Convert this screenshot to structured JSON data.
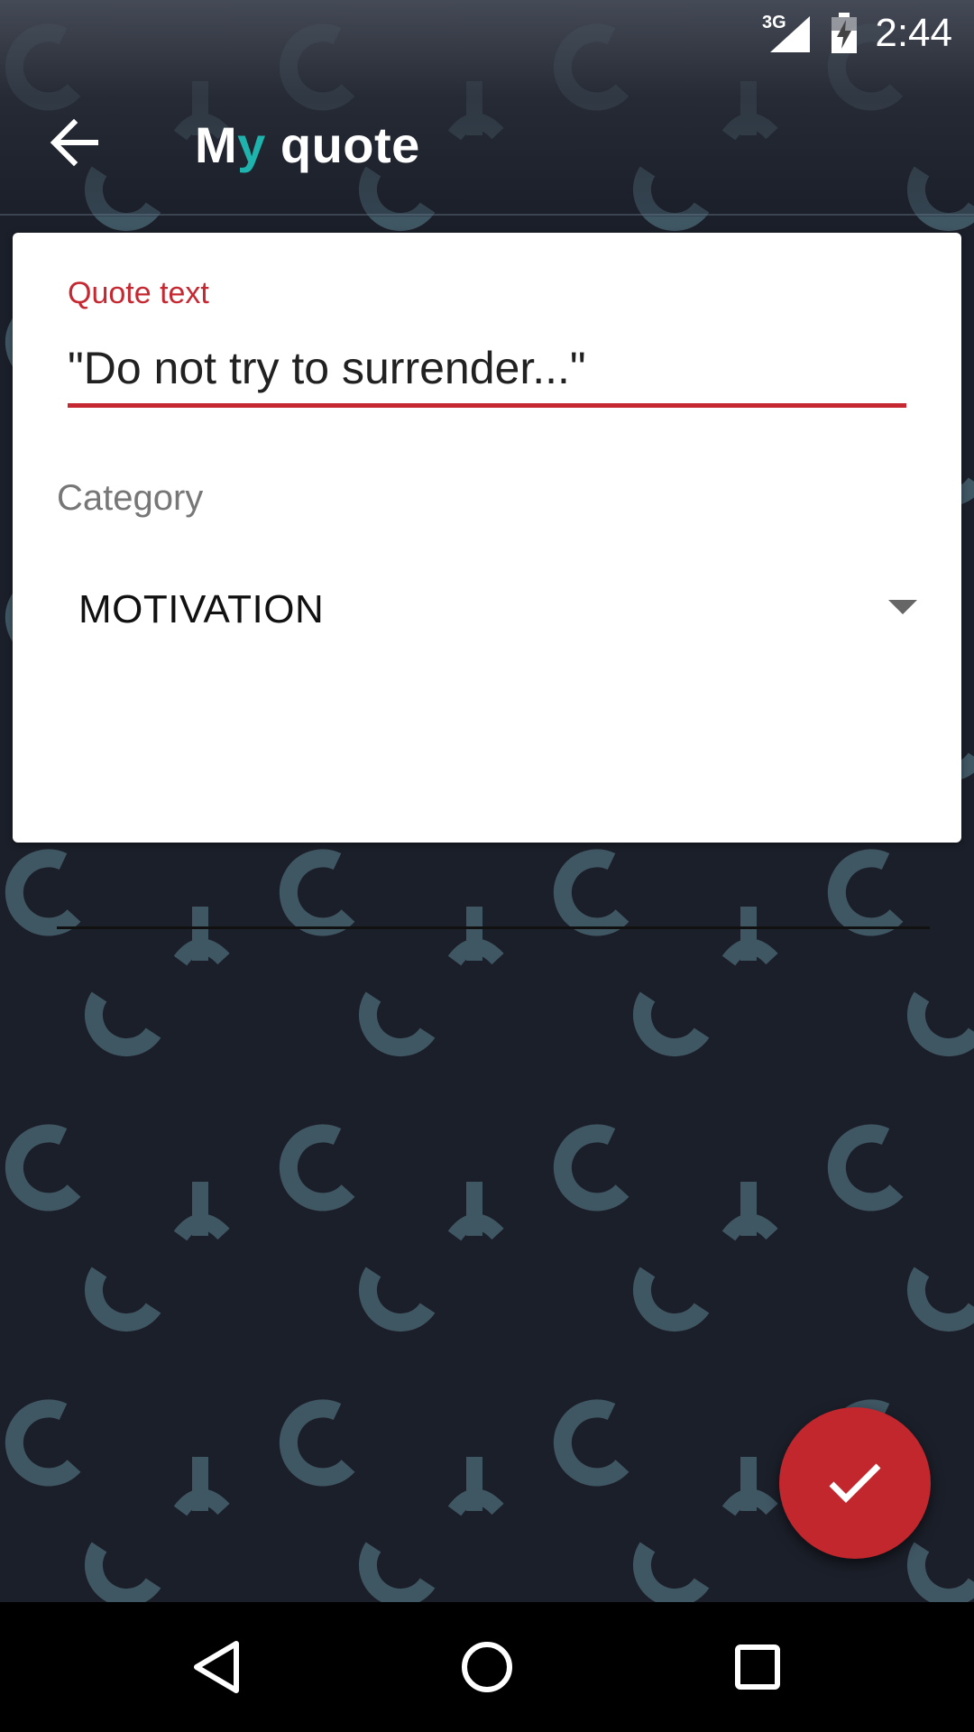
{
  "status_bar": {
    "network": "3G",
    "time": "2:44"
  },
  "app_bar": {
    "title_prefix": "M",
    "title_accent": "y",
    "title_suffix": " quote",
    "accent_color": "#1fb3ad"
  },
  "form": {
    "quote_label": "Quote text",
    "quote_value": "\"Do not try to surrender...\"",
    "category_label": "Category",
    "category_value": "MOTIVATION",
    "accent_color": "#c62832"
  },
  "fab": {
    "icon": "check-icon",
    "color": "#c1272d"
  },
  "nav_bar": {
    "buttons": [
      "back-icon",
      "home-icon",
      "recents-icon"
    ]
  }
}
